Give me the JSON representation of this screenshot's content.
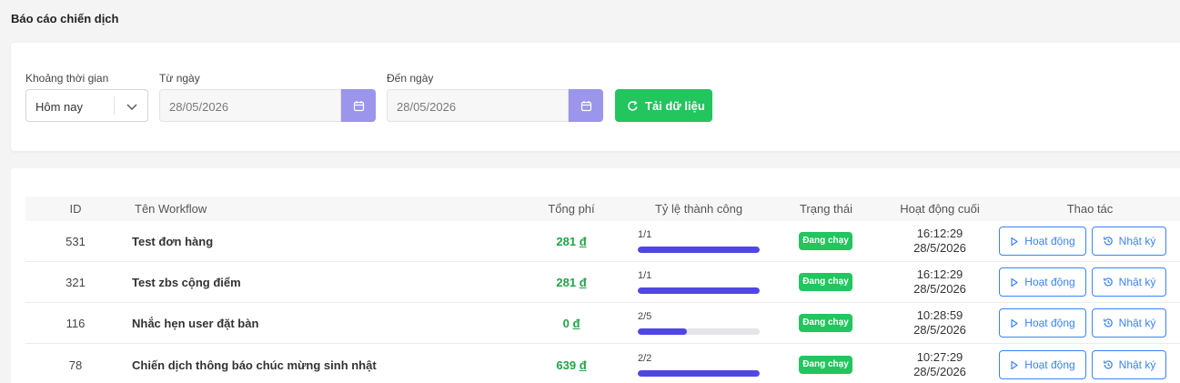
{
  "page": {
    "title": "Báo cáo chiến dịch"
  },
  "filters": {
    "period_label": "Khoảng thời gian",
    "period_value": "Hôm nay",
    "from_label": "Từ ngày",
    "from_value": "28/05/2026",
    "to_label": "Đến ngày",
    "to_value": "28/05/2026",
    "reload_label": "Tải dữ liệu"
  },
  "table": {
    "headers": {
      "id": "ID",
      "name": "Tên Workflow",
      "cost": "Tổng phí",
      "rate": "Tỷ lệ thành công",
      "status": "Trạng thái",
      "last": "Hoạt động cuối",
      "actions": "Thao tác"
    },
    "activity_label": "Hoạt động",
    "log_label": "Nhật ký",
    "currency": "đ",
    "rows": [
      {
        "id": "531",
        "name": "Test đơn hàng",
        "cost": "281",
        "rate": "1/1",
        "rate_fraction": 1.0,
        "status": "Đang chạy",
        "time": "16:12:29",
        "date": "28/5/2026"
      },
      {
        "id": "321",
        "name": "Test zbs cộng điểm",
        "cost": "281",
        "rate": "1/1",
        "rate_fraction": 1.0,
        "status": "Đang chạy",
        "time": "16:12:29",
        "date": "28/5/2026"
      },
      {
        "id": "116",
        "name": "Nhắc hẹn user đặt bàn",
        "cost": "0",
        "rate": "2/5",
        "rate_fraction": 0.4,
        "status": "Đang chạy",
        "time": "10:28:59",
        "date": "28/5/2026"
      },
      {
        "id": "78",
        "name": "Chiến dịch thông báo chúc mừng sinh nhật",
        "cost": "639",
        "rate": "2/2",
        "rate_fraction": 1.0,
        "status": "Đang chạy",
        "time": "10:27:29",
        "date": "28/5/2026"
      }
    ]
  },
  "colors": {
    "accent": "#4f46e5",
    "success": "#22c55e",
    "link": "#3b82f6",
    "calendar": "#9b95ec"
  }
}
